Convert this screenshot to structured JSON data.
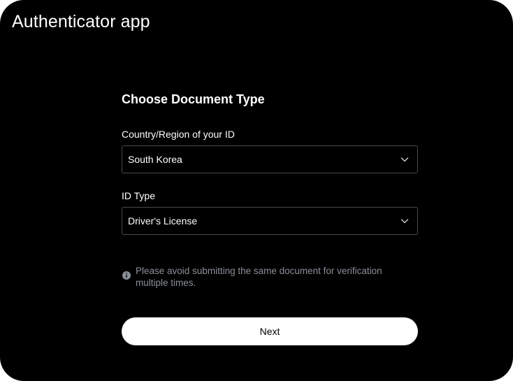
{
  "window": {
    "title": "Authenticator app"
  },
  "form": {
    "heading": "Choose Document Type",
    "country": {
      "label": "Country/Region of your ID",
      "value": "South Korea",
      "icon": "chevron-down-icon"
    },
    "id_type": {
      "label": "ID Type",
      "value": "Driver's License",
      "icon": "chevron-down-icon"
    },
    "notice": {
      "icon": "info-icon",
      "text": "Please avoid submitting the same document for verification multiple times."
    },
    "next_label": "Next"
  },
  "colors": {
    "background": "#000000",
    "text": "#ffffff",
    "muted_text": "#8a8f98",
    "border": "#4a4a4a",
    "button_bg": "#ffffff",
    "button_text": "#000000"
  }
}
